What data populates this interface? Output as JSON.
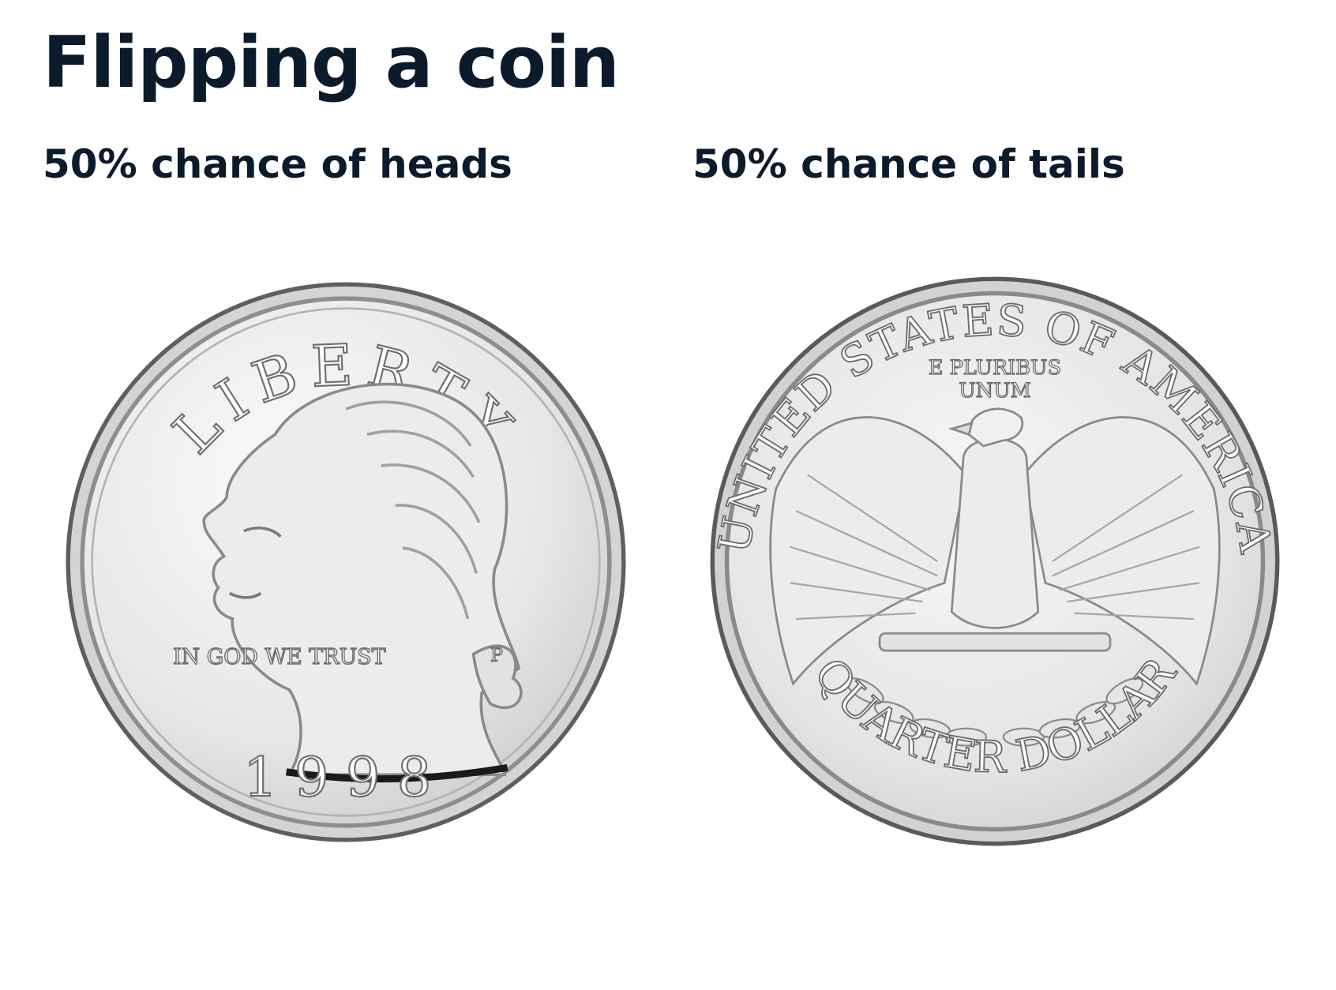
{
  "page": {
    "title": "Flipping a coin"
  },
  "outcomes": [
    {
      "side": "heads",
      "probability_label": "50% chance of heads"
    },
    {
      "side": "tails",
      "probability_label": "50% chance of tails"
    }
  ],
  "coins": {
    "heads": {
      "image": "quarter-obverse-washington",
      "legend_top": "LIBERTY",
      "motto": "IN GOD WE TRUST",
      "mint_mark": "P",
      "year": "1998"
    },
    "tails": {
      "image": "quarter-reverse-eagle",
      "legend_top": "UNITED STATES OF AMERICA",
      "motto_top": "E PLURIBUS",
      "motto_bottom": "UNUM",
      "denomination": "QUARTER DOLLAR"
    }
  },
  "colors": {
    "text": "#0c1b2c",
    "coin_face": "#e9e9e9",
    "coin_rim": "#9a9a9a",
    "coin_relief": "#c7c7c7"
  }
}
